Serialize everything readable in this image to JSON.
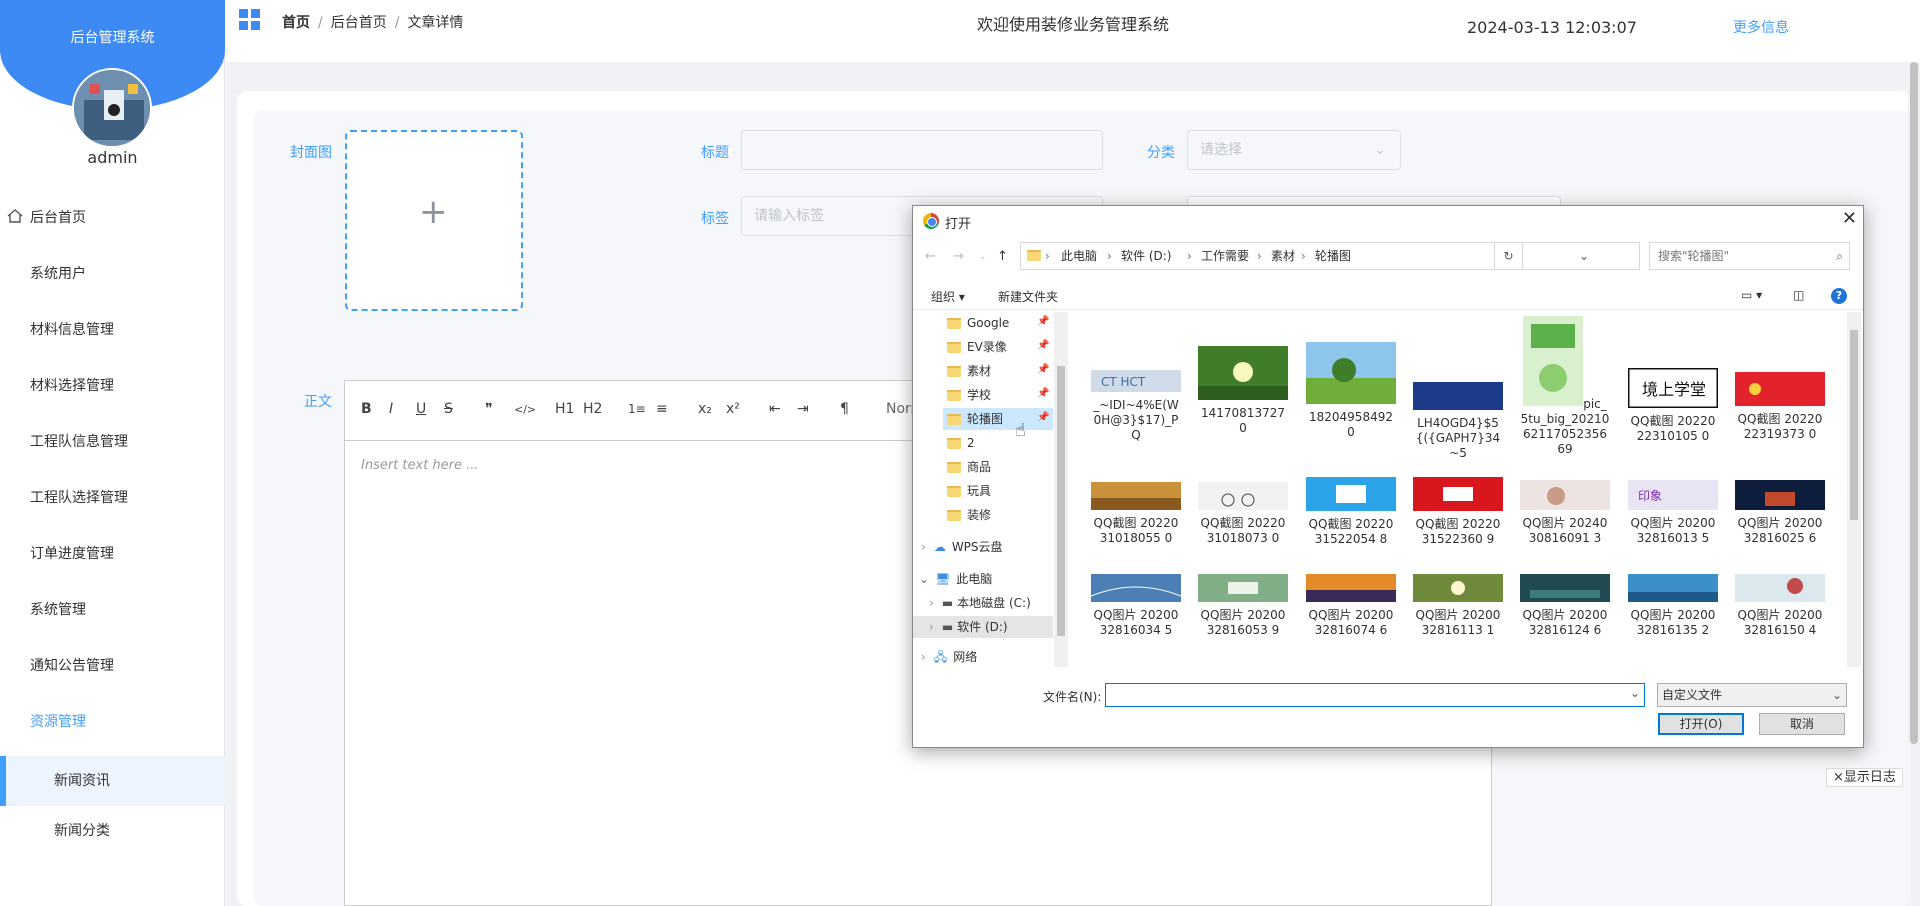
{
  "sidebar": {
    "system_title": "后台管理系统",
    "username": "admin",
    "menu": [
      {
        "label": "后台首页"
      },
      {
        "label": "系统用户"
      },
      {
        "label": "材料信息管理"
      },
      {
        "label": "材料选择管理"
      },
      {
        "label": "工程队信息管理"
      },
      {
        "label": "工程队选择管理"
      },
      {
        "label": "订单进度管理"
      },
      {
        "label": "系统管理"
      },
      {
        "label": "通知公告管理"
      },
      {
        "label": "资源管理"
      }
    ],
    "submenu": [
      {
        "label": "新闻资讯"
      },
      {
        "label": "新闻分类"
      }
    ]
  },
  "topbar": {
    "breadcrumb": [
      "首页",
      "后台首页",
      "文章详情"
    ],
    "welcome": "欢迎使用装修业务管理系统",
    "datetime": "2024-03-13 12:03:07",
    "more_info": "更多信息"
  },
  "form": {
    "cover_label": "封面图",
    "title_label": "标题",
    "category_label": "分类",
    "category_placeholder": "请选择",
    "tag_label": "标签",
    "tag_placeholder": "请输入标签",
    "body_label": "正文",
    "editor_placeholder": "Insert text here ...",
    "editor_toolbar": [
      "B",
      "I",
      "U",
      "S",
      "❞",
      "</>",
      "H1",
      "H2",
      "1≡",
      "≡",
      "x₂",
      "x²",
      "⇤",
      "⇥",
      "¶",
      "Norr"
    ]
  },
  "log_button": "×显示日志",
  "dialog": {
    "title": "打开",
    "path": [
      "此电脑",
      "软件 (D:)",
      "工作需要",
      "素材",
      "轮播图"
    ],
    "search_placeholder": "搜索\"轮播图\"",
    "organize": "组织 ▾",
    "new_folder": "新建文件夹",
    "tree": [
      {
        "label": "Google",
        "pinned": true
      },
      {
        "label": "EV录像",
        "pinned": true
      },
      {
        "label": "素材",
        "pinned": true
      },
      {
        "label": "学校",
        "pinned": true
      },
      {
        "label": "轮播图",
        "pinned": true
      },
      {
        "label": "2"
      },
      {
        "label": "商品"
      },
      {
        "label": "玩具"
      },
      {
        "label": "装修"
      },
      {
        "label": "WPS云盘"
      },
      {
        "label": "此电脑"
      },
      {
        "label": "本地磁盘 (C:)"
      },
      {
        "label": "软件 (D:)"
      },
      {
        "label": "网络"
      }
    ],
    "files": [
      {
        "name": "_~IDI~4%E(W0H@3}$17)_PQ"
      },
      {
        "name": "141708137270"
      },
      {
        "name": "182049584920"
      },
      {
        "name": "LH4OGD4}$5{({GAPH7}34~5"
      },
      {
        "name": "pic_5tu_big_2021062117052356 69"
      },
      {
        "name": "QQ截图 2022022310105 0"
      },
      {
        "name": "QQ截图 2022022319373 0"
      },
      {
        "name": "QQ截图 2022031018055 0"
      },
      {
        "name": "QQ截图 2022031018073 0"
      },
      {
        "name": "QQ截图 2022031522054 8"
      },
      {
        "name": "QQ截图 2022031522360 9"
      },
      {
        "name": "QQ图片 2024030816091 3"
      },
      {
        "name": "QQ图片 2020032816013 5"
      },
      {
        "name": "QQ图片 2020032816025 6"
      },
      {
        "name": "QQ图片 2020032816034 5"
      },
      {
        "name": "QQ图片 2020032816053 9"
      },
      {
        "name": "QQ图片 2020032816074 6"
      },
      {
        "name": "QQ图片 2020032816113 1"
      },
      {
        "name": "QQ图片 2020032816124 6"
      },
      {
        "name": "QQ图片 2020032816135 2"
      },
      {
        "name": "QQ图片 2020032816150 4"
      }
    ],
    "filename_label": "文件名(N):",
    "filetype": "自定义文件",
    "open_button": "打开(O)",
    "cancel_button": "取消"
  },
  "colors": {
    "accent": "#409eff",
    "header_blue": "#3e8af5",
    "win_blue": "#0078d7"
  }
}
